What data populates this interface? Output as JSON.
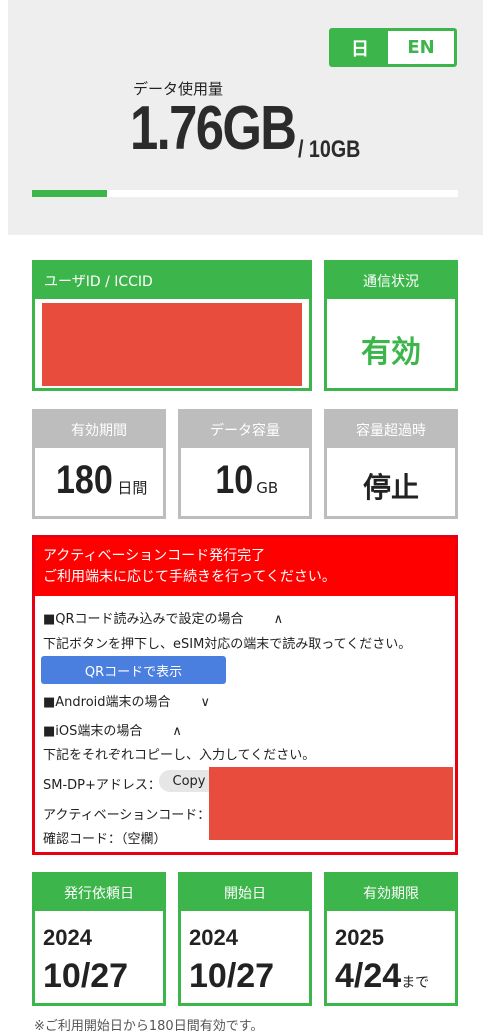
{
  "lang": {
    "ja": "日",
    "en": "EN",
    "selected": "ja"
  },
  "usage": {
    "label": "データ使用量",
    "value": "1.76GB",
    "total": "/ 10GB",
    "fraction": 0.176
  },
  "id_box": {
    "header": "ユーザID / ICCID"
  },
  "status_box": {
    "header": "通信状況",
    "value": "有効"
  },
  "stats": {
    "period": {
      "header": "有効期間",
      "number": "180",
      "unit": "日間"
    },
    "capacity": {
      "header": "データ容量",
      "number": "10",
      "unit": "GB"
    },
    "overflow": {
      "header": "容量超過時",
      "value": "停止"
    }
  },
  "activation": {
    "title_line1": "アクティベーションコード発行完了",
    "title_line2": "ご利用端末に応じて手続きを行ってください。",
    "qr_section": "■QRコード読み込みで設定の場合",
    "qr_desc": "下記ボタンを押下し、eSIM対応の端末で読み取ってください。",
    "qr_button": "QRコードで表示",
    "android_section": "■Android端末の場合",
    "ios_section": "■iOS端末の場合",
    "ios_desc": "下記をそれぞれコピーし、入力してください。",
    "smdp_label": "SM-DP+アドレス：",
    "copy_button": "Copy",
    "code_label": "アクティベーションコード：",
    "confirm_label": "確認コード：（空欄）",
    "chevron_up": "∧",
    "chevron_down": "∨"
  },
  "dates": {
    "request": {
      "header": "発行依頼日",
      "year": "2024",
      "md": "10/27",
      "suffix": ""
    },
    "start": {
      "header": "開始日",
      "year": "2024",
      "md": "10/27",
      "suffix": ""
    },
    "expire": {
      "header": "有効期限",
      "year": "2025",
      "md": "4/24",
      "suffix": "まで"
    }
  },
  "bottom_note": "※ご利用開始日から180日間有効です。",
  "colors": {
    "accent": "#3cb54a",
    "alert": "#ff0000",
    "redaction": "#e84c3d",
    "button": "#4a7fe0",
    "muted": "#bdbdbd"
  }
}
